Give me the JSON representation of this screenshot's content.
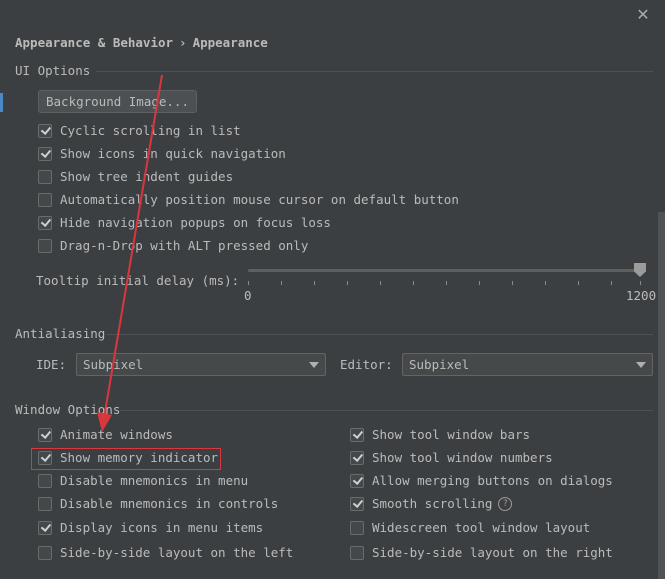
{
  "header": {
    "breadcrumb_parent": "Appearance & Behavior",
    "breadcrumb_sep": "›",
    "breadcrumb_current": "Appearance"
  },
  "ui_options": {
    "title": "UI Options",
    "background_image_button": "Background Image...",
    "checkboxes": [
      {
        "label": "Cyclic scrolling in list",
        "checked": true
      },
      {
        "label": "Show icons in quick navigation",
        "checked": true
      },
      {
        "label": "Show tree indent guides",
        "checked": false
      },
      {
        "label": "Automatically position mouse cursor on default button",
        "checked": false
      },
      {
        "label": "Hide navigation popups on focus loss",
        "checked": true
      },
      {
        "label": "Drag-n-Drop with ALT pressed only",
        "checked": false
      }
    ],
    "tooltip_label": "Tooltip initial delay (ms):",
    "tooltip_min": "0",
    "tooltip_max": "1200",
    "tooltip_value": 1200
  },
  "antialiasing": {
    "title": "Antialiasing",
    "ide_label": "IDE:",
    "ide_value": "Subpixel",
    "editor_label": "Editor:",
    "editor_value": "Subpixel"
  },
  "window_options": {
    "title": "Window Options",
    "left": [
      {
        "label": "Animate windows",
        "checked": true
      },
      {
        "label": "Show memory indicator",
        "checked": true
      },
      {
        "label": "Disable mnemonics in menu",
        "checked": false
      },
      {
        "label": "Disable mnemonics in controls",
        "checked": false
      },
      {
        "label": "Display icons in menu items",
        "checked": true
      },
      {
        "label": "Side-by-side layout on the left",
        "checked": false
      }
    ],
    "right": [
      {
        "label": "Show tool window bars",
        "checked": true
      },
      {
        "label": "Show tool window numbers",
        "checked": true
      },
      {
        "label": "Allow merging buttons on dialogs",
        "checked": true
      },
      {
        "label": "Smooth scrolling",
        "checked": true
      },
      {
        "label": "Widescreen tool window layout",
        "checked": false
      },
      {
        "label": "Side-by-side layout on the right",
        "checked": false
      }
    ],
    "help_glyph": "?"
  },
  "annotation_color": "#d9363e",
  "accent_color": "#4a88c7"
}
